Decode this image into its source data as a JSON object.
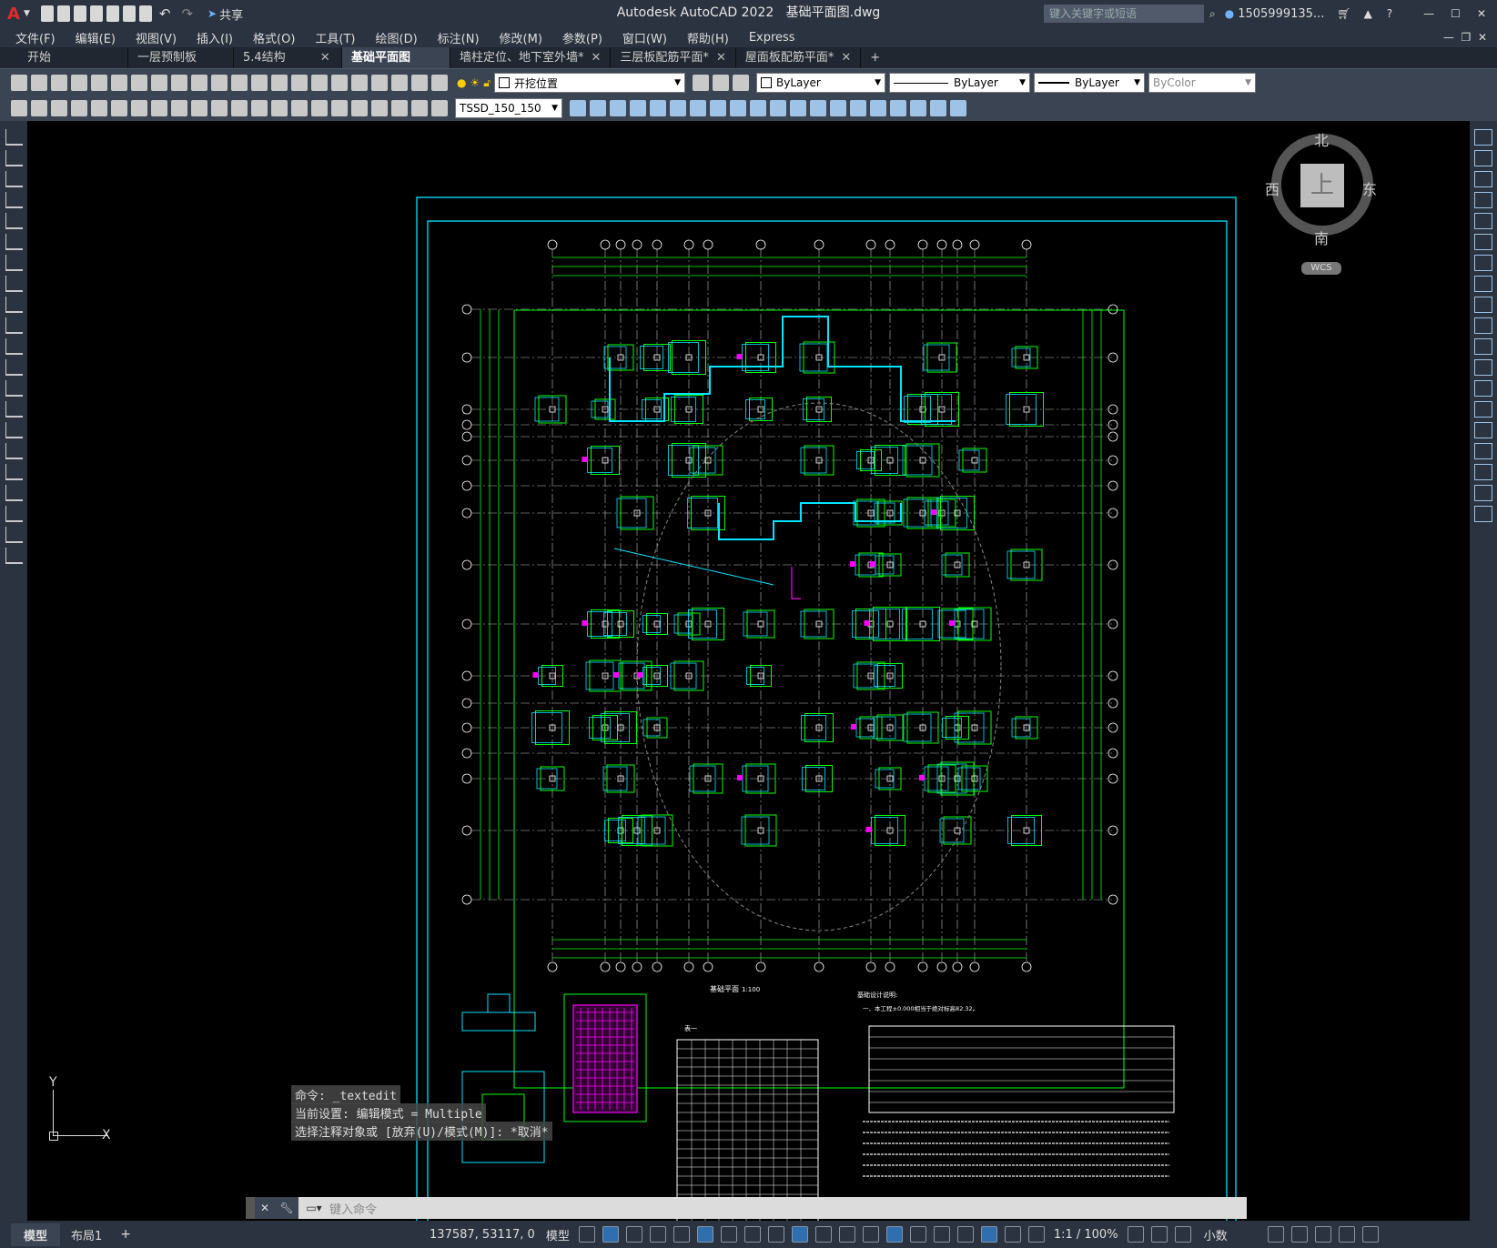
{
  "app": {
    "title": "Autodesk AutoCAD 2022",
    "file": "基础平面图.dwg",
    "share": "共享",
    "search_placeholder": "键入关键字或短语",
    "user": "1505999135...",
    "logo": "A"
  },
  "menu": [
    "文件(F)",
    "编辑(E)",
    "视图(V)",
    "插入(I)",
    "格式(O)",
    "工具(T)",
    "绘图(D)",
    "标注(N)",
    "修改(M)",
    "参数(P)",
    "窗口(W)",
    "帮助(H)",
    "Express"
  ],
  "tabs": [
    {
      "label": "开始",
      "active": false,
      "close": false
    },
    {
      "label": "一层预制板*",
      "active": false,
      "close": true
    },
    {
      "label": "5.4结构",
      "active": false,
      "close": true
    },
    {
      "label": "基础平面图*",
      "active": true,
      "close": true
    },
    {
      "label": "墙柱定位、地下室外墙*",
      "active": false,
      "close": true
    },
    {
      "label": "三层板配筋平面*",
      "active": false,
      "close": true
    },
    {
      "label": "屋面板配筋平面*",
      "active": false,
      "close": true
    }
  ],
  "toolbar": {
    "layer_name": "开挖位置",
    "color": "ByLayer",
    "linetype": "ByLayer",
    "lineweight": "ByLayer",
    "plotstyle": "ByColor",
    "textstyle": "TSSD_150_150"
  },
  "viewcube": {
    "north": "北",
    "south": "南",
    "east": "东",
    "west": "西",
    "top": "上",
    "wcs": "WCS"
  },
  "ucs": {
    "y": "Y",
    "x": "X"
  },
  "command": {
    "history": [
      "命令: _textedit",
      "当前设置: 编辑模式 = Multiple",
      "选择注释对象或 [放弃(U)/模式(M)]: *取消*"
    ],
    "placeholder": "键入命令"
  },
  "drawing": {
    "plan_title": "基础平面",
    "scale": "1:100",
    "notes_title": "基础设计说明:",
    "note1": "一、本工程±0.000相当于绝对标高82.32。",
    "table_label": "表一"
  },
  "status": {
    "layout_tabs": [
      "模型",
      "布局1"
    ],
    "coords": "137587, 53117, 0",
    "space": "模型",
    "scale": "1:1 / 100%",
    "units": "小数"
  },
  "colors": {
    "grid": "#00ff00",
    "frame": "#00e5ff",
    "footing": "#00ff00",
    "column": "#ffffff",
    "tag": "#ff00ff",
    "background": "#000000",
    "ui_dark": "#2b3340",
    "ui_mid": "#3b4453"
  }
}
